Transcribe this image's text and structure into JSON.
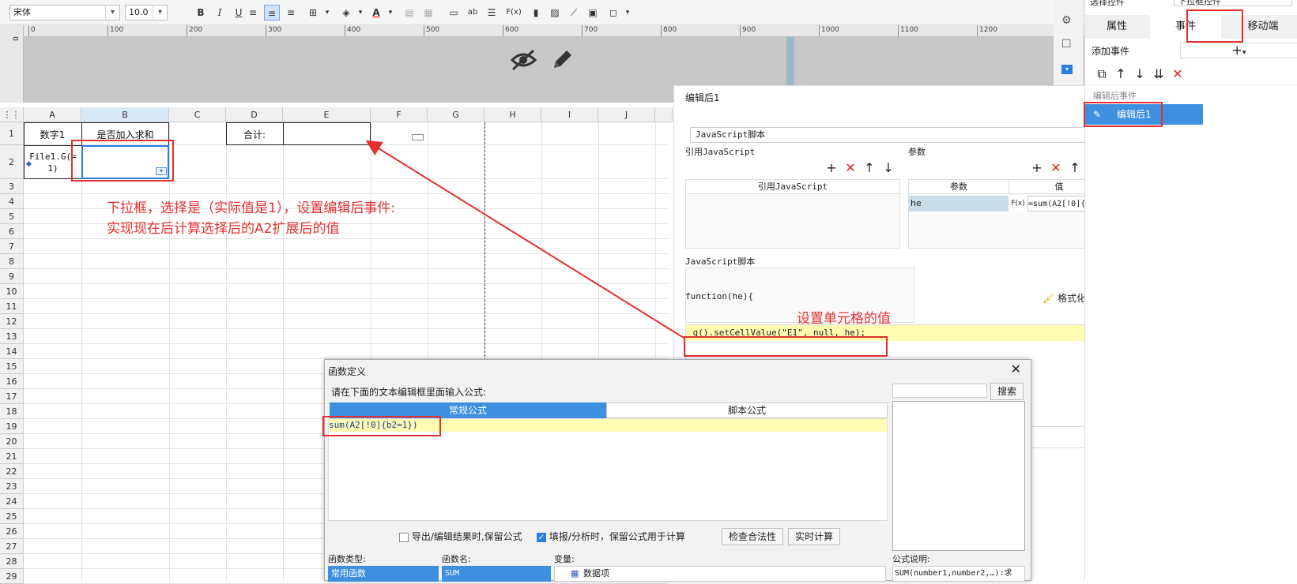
{
  "toolbar": {
    "font_name": "宋体",
    "font_size": "10.0",
    "bold_label": "B",
    "italic_label": "I",
    "underline_label": "U",
    "text_color_label": "A",
    "fx_label": "F(x)",
    "ab_label": "ab"
  },
  "ruler": {
    "ticks": [
      "0",
      "100",
      "200",
      "300",
      "400",
      "500",
      "600",
      "700",
      "800",
      "900",
      "1000",
      "1100",
      "1200",
      "1300"
    ],
    "v_tick": "0"
  },
  "columns": [
    "A",
    "B",
    "C",
    "D",
    "E",
    "F",
    "G",
    "H",
    "I",
    "J"
  ],
  "rows": [
    "1",
    "2",
    "3",
    "4",
    "5",
    "6",
    "7",
    "8",
    "9",
    "10",
    "11",
    "12",
    "13",
    "14",
    "15",
    "16",
    "17",
    "18",
    "19",
    "20",
    "21",
    "22",
    "23",
    "24",
    "25",
    "26",
    "27",
    "28",
    "29"
  ],
  "cells": {
    "a1": "数字1",
    "b1": "是否加入求和",
    "d1": "合计:",
    "a2": "File1.G(=1)"
  },
  "annotations": {
    "note1_line1": "下拉框，选择是（实际值是1），设置编辑后事件:",
    "note1_line2": "实现现在后计算选择后的A2扩展后的值",
    "note2": "设置单元格的值"
  },
  "right_panel": {
    "top_label": "选择控件",
    "top_value": "下拉框控件",
    "tabs": [
      "属性",
      "事件",
      "移动端"
    ],
    "add_event_label": "添加事件",
    "section_label": "编辑后事件",
    "event_item": "编辑后1"
  },
  "edit_panel": {
    "title": "编辑后1",
    "script_type": "JavaScript脚本",
    "ref_js_label": "引用JavaScript",
    "ref_js_col": "引用JavaScript",
    "params_label": "参数",
    "params_cols": [
      "参数",
      "值"
    ],
    "param_name": "he",
    "param_fx": "F(x)",
    "param_value": "=sum(A2[!0]{b2=1",
    "script_label": "JavaScript脚本",
    "func_header": "function(he){",
    "format_code": "格式化代码",
    "code_line": "_g().setCellValue(\"E1\", null, he);"
  },
  "dialog": {
    "title": "函数定义",
    "instruction": "请在下面的文本编辑框里面输入公式:",
    "search_label": "搜索",
    "tab_normal": "常规公式",
    "tab_script": "脚本公式",
    "formula": "sum(A2[!0]{b2=1})",
    "opt1": "导出/编辑结果时,保留公式",
    "opt2": "填报/分析时，保留公式用于计算",
    "check_btn": "检查合法性",
    "calc_btn": "实时计算",
    "func_type_label": "函数类型:",
    "func_name_label": "函数名:",
    "var_label": "变量:",
    "desc_label": "公式说明:",
    "func_type_value": "常用函数",
    "func_name_value": "SUM",
    "var_value": "数据项",
    "desc_value": "SUM(number1,number2,…):求"
  }
}
